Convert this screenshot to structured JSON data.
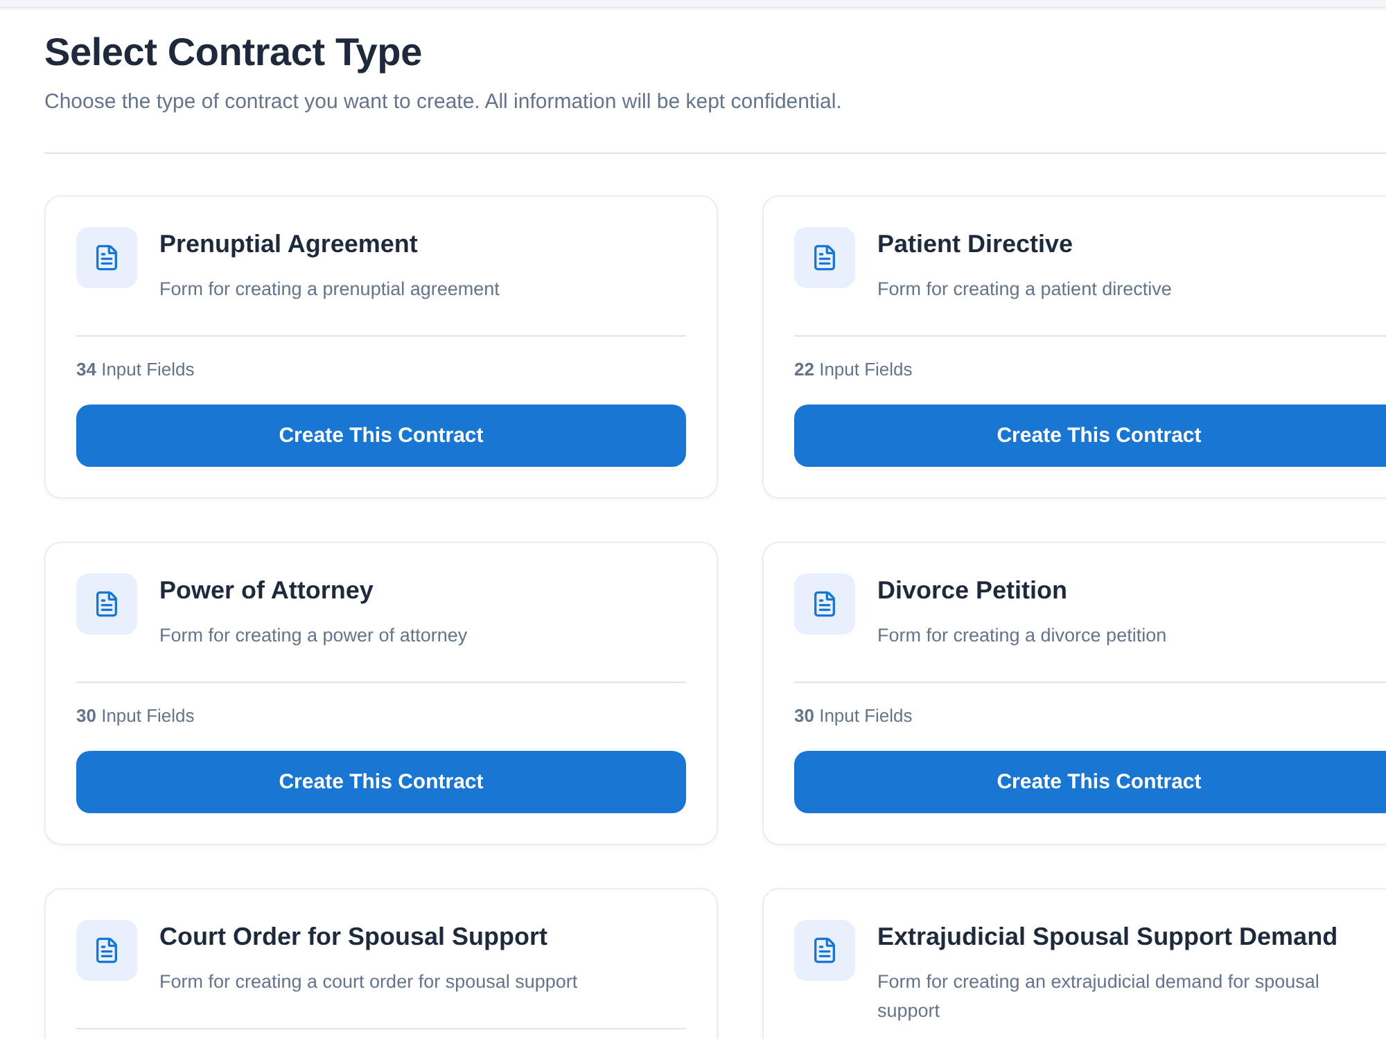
{
  "page": {
    "title": "Select Contract Type",
    "subtitle": "Choose the type of contract you want to create. All information will be kept confidential."
  },
  "contracts": [
    {
      "title": "Prenuptial Agreement",
      "description": "Form for creating a prenuptial agreement",
      "fields": "**34** Input Fields",
      "button": "Create This Contract"
    },
    {
      "title": "Patient Directive",
      "description": "Form for creating a patient directive",
      "fields": "**22** Input Fields",
      "button": "Create This Contract"
    },
    {
      "title": "Power of Attorney",
      "description": "Form for creating a power of attorney",
      "fields": "**30** Input Fields",
      "button": "Create This Contract"
    },
    {
      "title": "Divorce Petition",
      "description": "Form for creating a divorce petition",
      "fields": "**30** Input Fields",
      "button": "Create This Contract"
    },
    {
      "title": "Court Order for Spousal Support",
      "description": "Form for creating a court order for spousal support"
    },
    {
      "title": "Extrajudicial Spousal Support Demand",
      "description": "Form for creating an extrajudicial demand for spousal support"
    }
  ]
}
